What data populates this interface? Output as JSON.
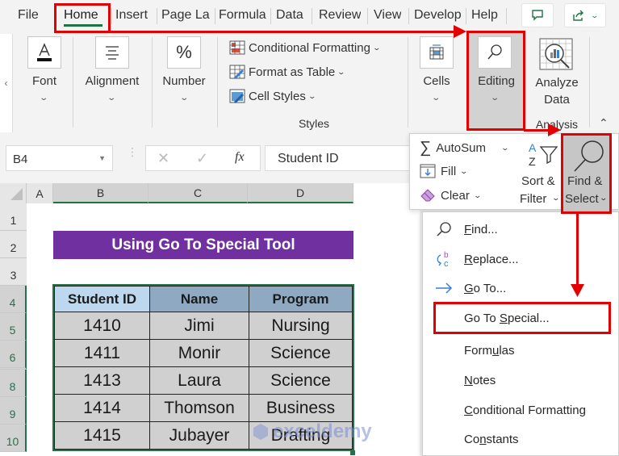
{
  "tabs": [
    {
      "label": "File"
    },
    {
      "label": "Home",
      "active": true
    },
    {
      "label": "Insert"
    },
    {
      "label": "Page La"
    },
    {
      "label": "Formula"
    },
    {
      "label": "Data"
    },
    {
      "label": "Review"
    },
    {
      "label": "View"
    },
    {
      "label": "Develop"
    },
    {
      "label": "Help"
    }
  ],
  "header_buttons": {
    "comments_icon": "comment-icon",
    "share_icon": "share-icon"
  },
  "ribbon": {
    "font": {
      "label": "Font"
    },
    "alignment": {
      "label": "Alignment"
    },
    "number": {
      "label": "Number",
      "glyph": "%"
    },
    "styles": {
      "group_label": "Styles",
      "items": [
        {
          "label": "Conditional Formatting"
        },
        {
          "label": "Format as Table"
        },
        {
          "label": "Cell Styles"
        }
      ]
    },
    "cells": {
      "label": "Cells"
    },
    "editing": {
      "label": "Editing"
    },
    "analyze": {
      "label_line1": "Analyze",
      "label_line2": "Data",
      "group_label": "Analysis"
    }
  },
  "formula_bar": {
    "name_box": "B4",
    "fx": "fx",
    "value": "Student ID"
  },
  "grid": {
    "columns": [
      "A",
      "B",
      "C",
      "D"
    ],
    "rows": [
      "1",
      "2",
      "3",
      "4",
      "5",
      "6",
      "8",
      "9",
      "10"
    ],
    "selected_row_start": "4",
    "title": "Using Go To Special Tool",
    "table": {
      "headers": [
        "Student ID",
        "Name",
        "Program"
      ],
      "rows": [
        [
          "1410",
          "Jimi",
          "Nursing"
        ],
        [
          "1411",
          "Monir",
          "Science"
        ],
        [
          "1413",
          "Laura",
          "Science"
        ],
        [
          "1414",
          "Thomson",
          "Business"
        ],
        [
          "1415",
          "Jubayer",
          "Drafting"
        ]
      ]
    },
    "watermark": "exceldemy"
  },
  "editing_panel": {
    "autosum": "AutoSum",
    "fill": "Fill",
    "clear": "Clear",
    "sort_filter_line1": "Sort &",
    "sort_filter_line2": "Filter",
    "find_select_line1": "Find &",
    "find_select_line2": "Select"
  },
  "find_select_menu": {
    "items": [
      {
        "label": "Find...",
        "u": "F",
        "rest": "ind...",
        "icon": "magnifier-icon"
      },
      {
        "label": "Replace...",
        "u": "R",
        "rest": "eplace...",
        "icon": "replace-icon"
      },
      {
        "label": "Go To...",
        "u": "G",
        "rest": "o To...",
        "icon": "arrow-right-icon"
      },
      {
        "label": "Go To Special...",
        "pre": "Go To ",
        "u": "S",
        "rest": "pecial...",
        "highlighted": true
      },
      {
        "label": "Formulas",
        "pre": "Form",
        "u": "u",
        "rest": "las"
      },
      {
        "label": "Notes",
        "u": "N",
        "rest": "otes"
      },
      {
        "label": "Conditional Formatting",
        "u": "C",
        "rest": "onditional Formatting"
      },
      {
        "label": "Constants",
        "pre": "Co",
        "u": "n",
        "rest": "stants"
      }
    ]
  },
  "colors": {
    "excel_green": "#217346",
    "annotation_red": "#e30000",
    "title_purple": "#7030a0",
    "header_blue": "#8ea9c1",
    "header_light_blue": "#bdd7ee"
  }
}
